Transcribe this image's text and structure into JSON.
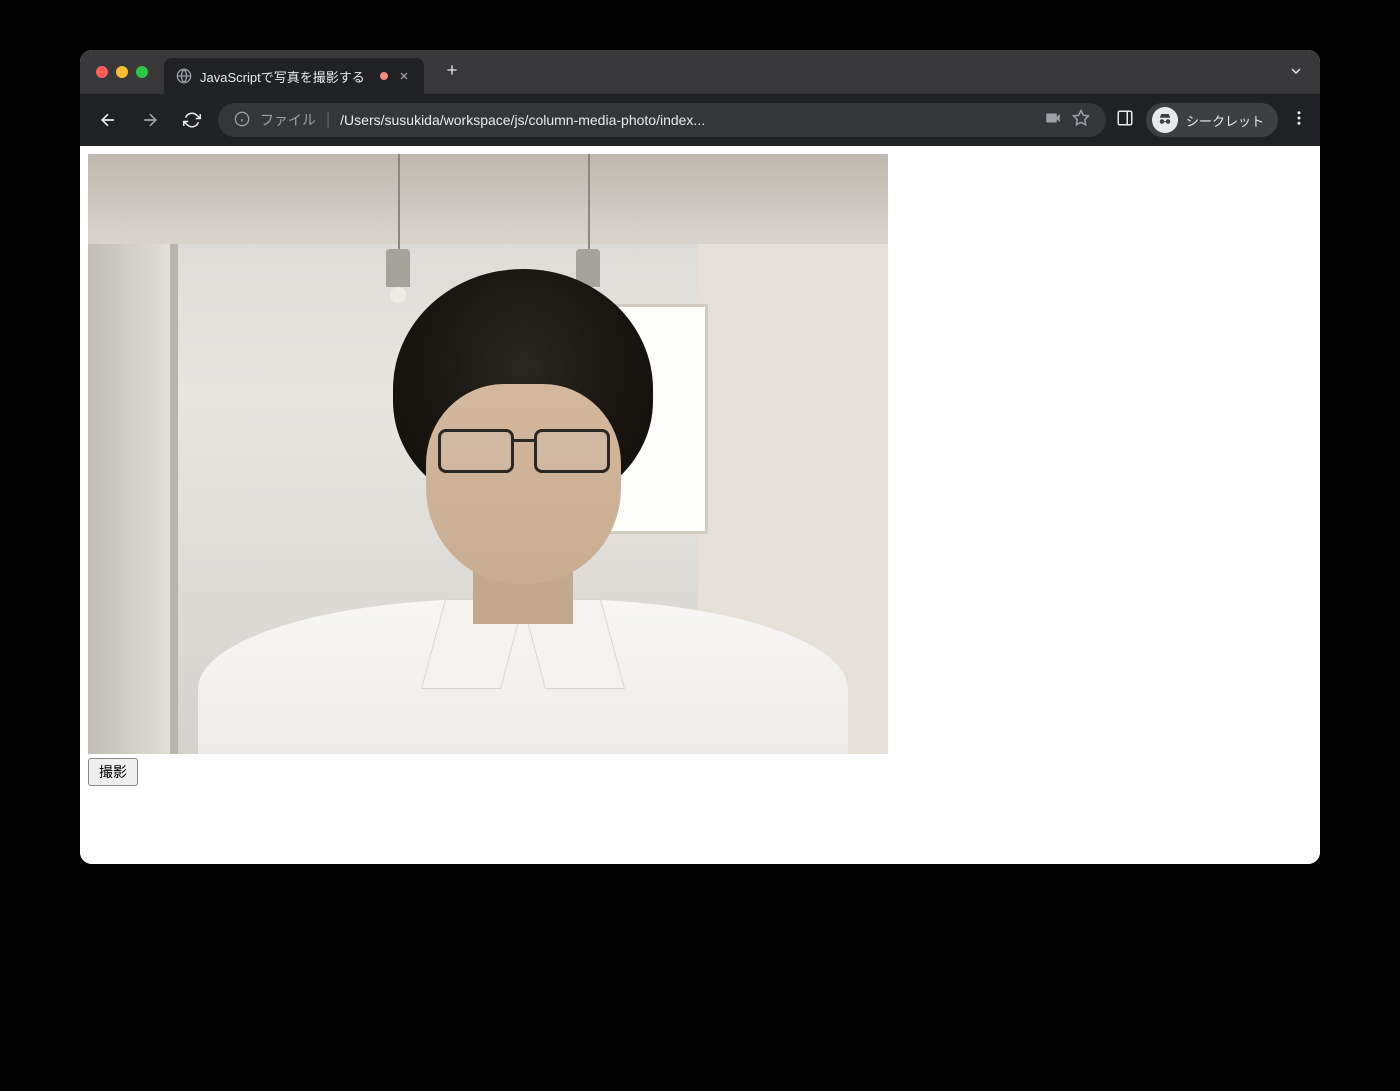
{
  "tab": {
    "title": "JavaScriptで写真を撮影する"
  },
  "address": {
    "scheme_label": "ファイル",
    "path": "/Users/susukida/workspace/js/column-media-photo/index..."
  },
  "incognito_label": "シークレット",
  "page": {
    "capture_button_label": "撮影"
  }
}
